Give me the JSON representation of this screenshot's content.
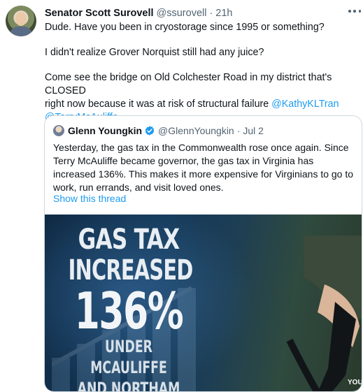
{
  "tweet": {
    "author_name": "Senator Scott Surovell",
    "author_handle": "@ssurovell",
    "separator": "·",
    "time": "21h",
    "lines": {
      "p1": "Dude.   Have you been in cryostorage since 1995 or something?",
      "p2": "I didn't realize Grover Norquist still had any juice?",
      "p3_line1": "Come see the bridge on Old Colchester Road in my district that's CLOSED",
      "p3_line2_text": "right now because it was at risk of structural failure",
      "mention1": "@KathyKLTran",
      "mention2": "@TerryMcAuliffe"
    }
  },
  "quote": {
    "author_name": "Glenn Youngkin",
    "author_handle": "@GlennYoungkin",
    "separator": "·",
    "time": "Jul 2",
    "text": "Yesterday, the gas tax in the Commonwealth rose once again. Since Terry McAuliffe became governor, the gas tax in Virginia has increased 136%. This makes it more expensive for Virginians to go to work, run errands, and visit loved ones.",
    "show_thread": "Show this thread",
    "media": {
      "line1": "GAS TAX",
      "line2": "INCREASED",
      "line3": "136%",
      "line4": "UNDER MCAULIFFE",
      "line5": "AND NORTHAM",
      "watermark": "YOU"
    }
  },
  "icons": {
    "more": "more-dots-icon",
    "verified": "verified-badge-icon"
  },
  "colors": {
    "link": "#1d9bf0",
    "secondary_text": "#536471",
    "border": "#cfd9de"
  }
}
